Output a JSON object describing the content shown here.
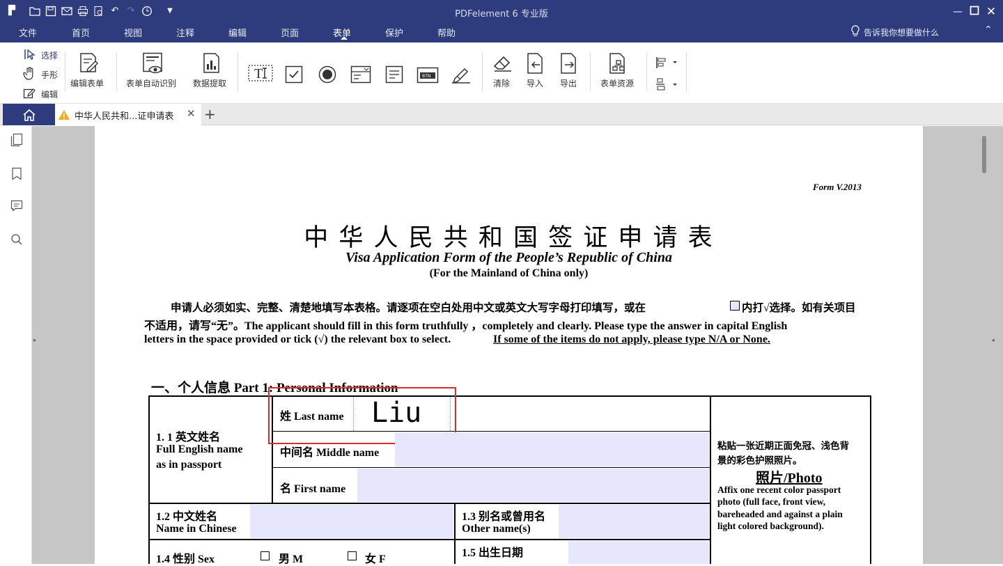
{
  "app": {
    "title": "PDFelement  6 专业版",
    "tell_me": "告诉我你想要做什么"
  },
  "menu": [
    "文件",
    "首页",
    "视图",
    "注释",
    "编辑",
    "页面",
    "表单",
    "保护",
    "帮助"
  ],
  "ribbon": {
    "select": "选择",
    "hand": "手形",
    "edit": "编辑",
    "edit_form": "编辑表单",
    "auto_recognize": "表单自动识别",
    "data_extract": "数据提取",
    "clear": "清除",
    "import": "导入",
    "export": "导出",
    "form_resources": "表单资源"
  },
  "tab": {
    "doc_title": "中华人民共和...证申请表"
  },
  "doc": {
    "form_version": "Form V.2013",
    "title_cn": "中 华 人 民 共 和 国 签 证 申 请 表",
    "title_en": "Visa Application Form of the People’s Republic of China",
    "subtitle": "(For the Mainland of China only)",
    "instr_line1": "申请人必须如实、完整、清楚地填写本表格。请逐项在空白处用中文或英文大写字母打印填写，或在",
    "instr_line1b": "内打√选择。如有关项目",
    "instr_line2": "不适用，请写“无”。The applicant should fill in this form truthfully  ，completely and clearly. Please type the answer in capital English",
    "instr_line3": "letters in the space provided or tick (√) the relevant box to select.",
    "instr_line3_underlined": "If some of the items do not apply, please type N/A or None.",
    "part1": "一、个人信息  Part 1: Personal Information",
    "f11_cn": "1. 1 英文姓名",
    "f11_en1": "Full English name",
    "f11_en2": "as in passport",
    "last_name_label": "姓 Last name",
    "last_name_value": "Liu",
    "middle_name_label": "中间名 Middle name",
    "first_name_label": "名 First name",
    "f12_cn": "1.2 中文姓名",
    "f12_en": "Name in Chinese",
    "f13_cn": "1.3 别名或曾用名",
    "f13_en": "Other name(s)",
    "f14": "1.4 性别 Sex",
    "male": "男 M",
    "female": "女 F",
    "f15": "1.5 出生日期",
    "photo_cn1": "粘贴一张近期正面免冠、浅色背",
    "photo_cn2": "景的彩色护照照片。",
    "photo_title": "照片/Photo",
    "photo_en1": "Affix one recent color passport",
    "photo_en2": "photo (full face, front view,",
    "photo_en3": "bareheaded and against a plain",
    "photo_en4": "light colored background)."
  }
}
